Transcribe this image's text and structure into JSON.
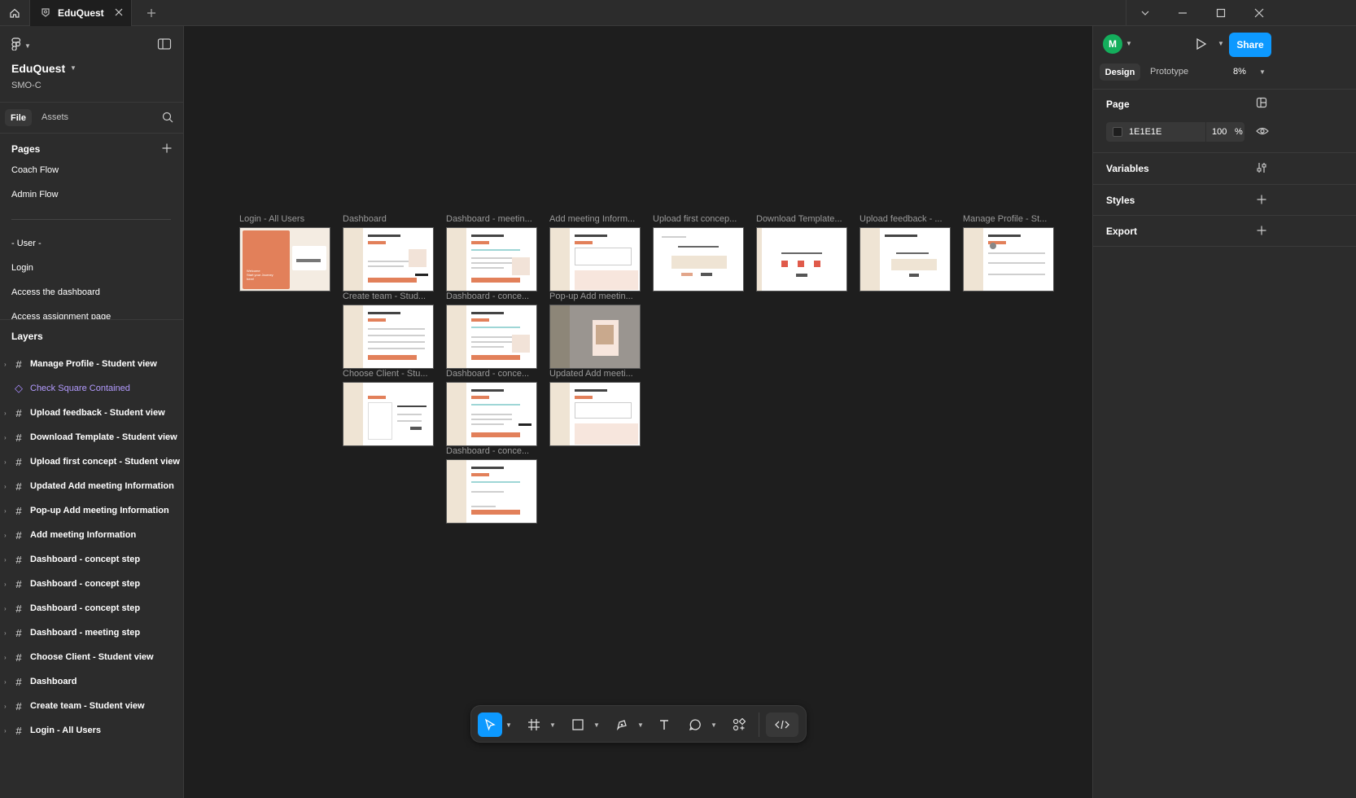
{
  "titlebar": {
    "tab_title": "EduQuest"
  },
  "header": {
    "project_name": "EduQuest",
    "team": "SMO-C"
  },
  "left_tabs": {
    "file": "File",
    "assets": "Assets"
  },
  "pages": {
    "title": "Pages",
    "items": [
      "Coach Flow",
      "Admin Flow",
      "- User -",
      "Login",
      "Access the dashboard",
      "Access assignment page"
    ]
  },
  "layers": {
    "title": "Layers",
    "items": [
      "Manage Profile - Student view",
      "Check Square Contained",
      "Upload feedback - Student view",
      "Download Template - Student view",
      "Upload first concept - Student view",
      "Updated Add meeting Information",
      "Pop-up Add meeting Information",
      "Add meeting Information",
      "Dashboard - concept step",
      "Dashboard - concept step",
      "Dashboard - concept step",
      "Dashboard - meeting step",
      "Choose Client - Student view",
      "Dashboard",
      "Create team - Student view",
      "Login - All Users"
    ]
  },
  "canvas": {
    "frame_labels": {
      "login": "Login - All Users",
      "dashboard": "Dashboard",
      "dash_meeting": "Dashboard - meetin...",
      "add_meeting": "Add meeting Inform...",
      "upload_concept": "Upload first concep...",
      "download_template": "Download Template...",
      "upload_feedback": "Upload feedback - ...",
      "manage_profile": "Manage Profile - St...",
      "create_team": "Create team - Stud...",
      "dash_concept_1": "Dashboard - conce...",
      "popup_meeting": "Pop-up Add meetin...",
      "choose_client": "Choose Client - Stu...",
      "dash_concept_2": "Dashboard - conce...",
      "updated_meeting": "Updated Add meeti...",
      "dash_concept_3": "Dashboard - conce..."
    },
    "login_frame_text": "Welcome\nStart your Journey\nhere!"
  },
  "right_panel": {
    "avatar_initial": "M",
    "avatar_color": "#14ae5c",
    "share": "Share",
    "share_color": "#0d99ff",
    "tabs": {
      "design": "Design",
      "prototype": "Prototype"
    },
    "zoom": "8%",
    "page": {
      "title": "Page",
      "fill_hex": "1E1E1E",
      "opacity": "100",
      "percent": "%"
    },
    "variables": "Variables",
    "styles": "Styles",
    "export": "Export"
  },
  "help": "?",
  "icons": [
    "home-icon",
    "figma-logo-icon",
    "sidebar-toggle-icon",
    "search-icon",
    "plus-icon",
    "frame-icon",
    "component-icon",
    "move-tool-icon",
    "frame-tool-icon",
    "shape-tool-icon",
    "pen-tool-icon",
    "text-tool-icon",
    "comment-icon",
    "actions-icon",
    "dev-mode-icon",
    "play-icon",
    "eye-icon",
    "adjust-icon",
    "style-icon"
  ]
}
